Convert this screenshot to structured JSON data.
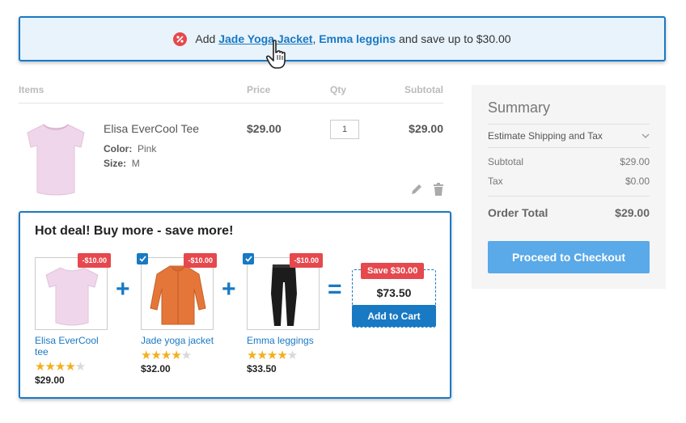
{
  "promo": {
    "prefix": "Add",
    "product_1": "Jade Yoga Jacket",
    "separator": ",",
    "product_2": "Emma leggins",
    "suffix": "and save up to $30.00"
  },
  "cart": {
    "headers": {
      "items": "Items",
      "price": "Price",
      "qty": "Qty",
      "subtotal": "Subtotal"
    },
    "item": {
      "name": "Elisa EverCool Tee",
      "color_label": "Color:",
      "color": "Pink",
      "size_label": "Size:",
      "size": "M",
      "price": "$29.00",
      "qty": "1",
      "subtotal": "$29.00"
    }
  },
  "deal": {
    "title": "Hot deal! Buy more - save more!",
    "products": [
      {
        "name": "Elisa EverCool tee",
        "price": "$29.00",
        "discount": "-$10.00",
        "rating": 4,
        "checked": false
      },
      {
        "name": "Jade yoga jacket",
        "price": "$32.00",
        "discount": "-$10.00",
        "rating": 4,
        "checked": true
      },
      {
        "name": "Emma leggings",
        "price": "$33.50",
        "discount": "-$10.00",
        "rating": 4,
        "checked": true
      }
    ],
    "plus": "+",
    "equals": "=",
    "save_badge": "Save $30.00",
    "total_price": "$73.50",
    "add_to_cart": "Add to Cart"
  },
  "summary": {
    "title": "Summary",
    "estimate": "Estimate Shipping and Tax",
    "subtotal_label": "Subtotal",
    "subtotal": "$29.00",
    "tax_label": "Tax",
    "tax": "$0.00",
    "total_label": "Order Total",
    "total": "$29.00",
    "checkout": "Proceed to Checkout"
  },
  "colors": {
    "accent": "#1979c3",
    "badge": "#e5484d",
    "checkout": "#5aa9e8",
    "star": "#f2b01e"
  },
  "icons": [
    "percent-icon",
    "hand-cursor-icon",
    "edit-icon",
    "trash-icon",
    "checkbox-icon",
    "chevron-down-icon",
    "star-icon"
  ]
}
